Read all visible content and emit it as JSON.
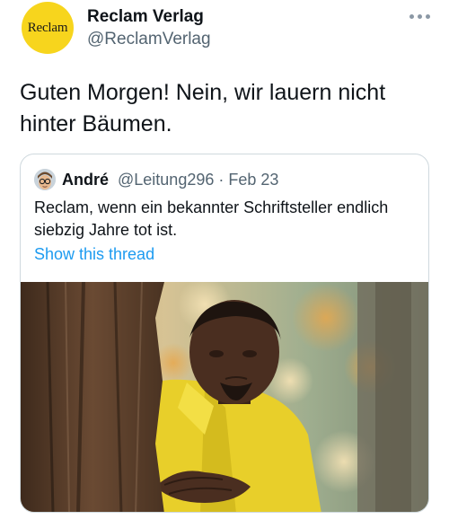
{
  "tweet": {
    "author": {
      "name": "Reclam Verlag",
      "handle": "@ReclamVerlag",
      "avatar_text": "Reclam"
    },
    "text": "Guten Morgen! Nein, wir lauern nicht hinter Bäumen.",
    "more_icon": "more-horizontal-icon",
    "quoted": {
      "author_name": "André",
      "handle": "@Leitung296",
      "separator": " · ",
      "date": "Feb 23",
      "text": "Reclam, wenn ein bekannter Schriftsteller endlich siebzig Jahre tot ist.",
      "show_thread_label": "Show this thread",
      "media": "meme photo of a man in a yellow suit peeking from behind a tree"
    }
  },
  "colors": {
    "text_primary": "#0f1419",
    "text_secondary": "#536471",
    "link": "#1d9bf0",
    "border": "#cfd9de",
    "reclam_yellow": "#f7d51d"
  }
}
